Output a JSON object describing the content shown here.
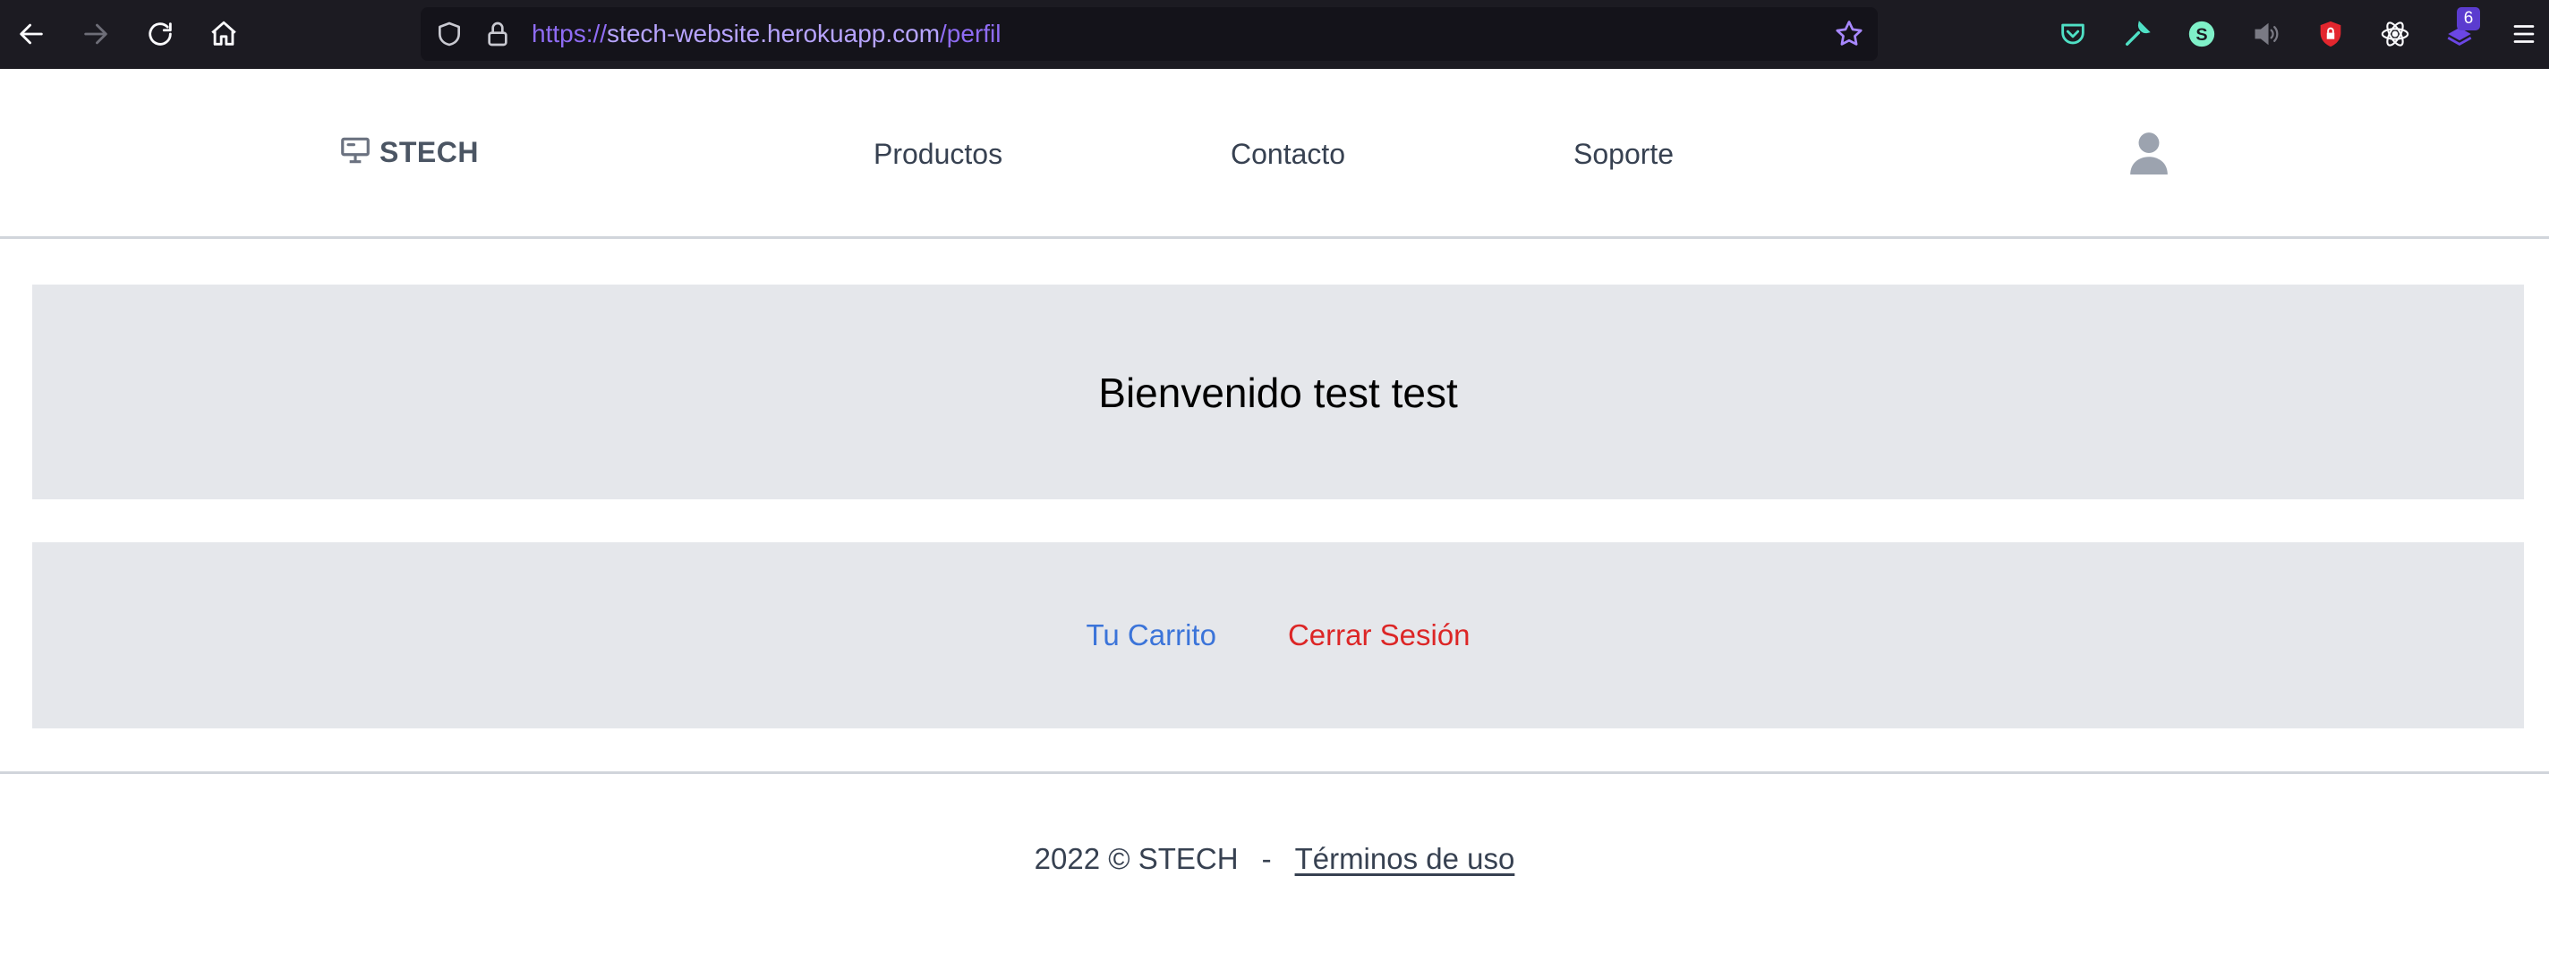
{
  "browser": {
    "url_protocol": "https://",
    "url_host": "stech-website.herokuapp.com",
    "url_path": "/perfil",
    "extension_badge": "6",
    "icons": [
      "back-arrow-icon",
      "forward-arrow-icon",
      "reload-icon",
      "home-icon",
      "shield-icon",
      "lock-icon",
      "bookmark-star-icon",
      "pocket-icon",
      "wrench-icon",
      "s-extension-icon",
      "speaker-icon",
      "shield-lock-extension-icon",
      "react-icon",
      "extension-icon",
      "hamburger-menu-icon"
    ]
  },
  "header": {
    "logo_text": "STECH",
    "nav": [
      {
        "label": "Productos"
      },
      {
        "label": "Contacto"
      },
      {
        "label": "Soporte"
      }
    ]
  },
  "main": {
    "welcome": "Bienvenido test test",
    "cart_link": "Tu Carrito",
    "logout_link": "Cerrar Sesión"
  },
  "footer": {
    "copyright": "2022 © STECH",
    "separator": "-",
    "terms_link": "Términos de uso"
  },
  "colors": {
    "toolbar_bg": "#1c1b22",
    "panel_bg": "#e5e7eb",
    "cart_link": "#3b74d9",
    "logout_link": "#dc2626"
  }
}
